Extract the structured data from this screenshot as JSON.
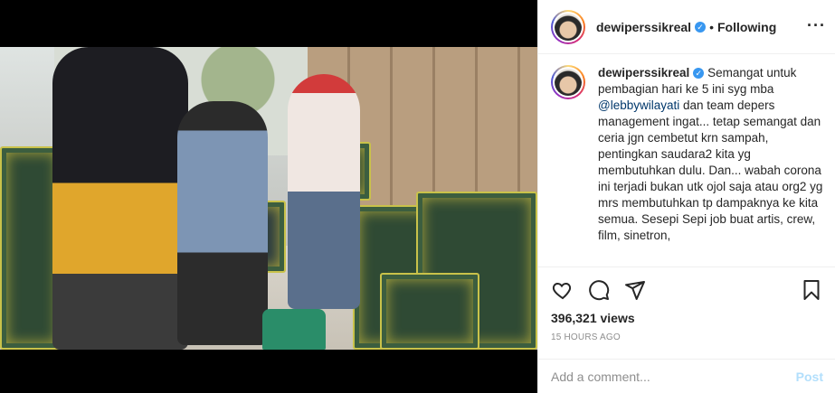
{
  "post": {
    "username": "dewiperssikreal",
    "follow_status": "Following",
    "separator": "•",
    "more_icon": "more-horizontal-icon"
  },
  "caption": {
    "username": "dewiperssikreal",
    "text_before": "Semangat untuk pembagian hari ke 5 ini syg mba ",
    "mention": "@lebbywilayati",
    "text_after": " dan team depers management ingat... tetap semangat dan ceria jgn cembetut krn sampah, pentingkan saudara2 kita yg membutuhkan dulu. Dan... wabah corona ini terjadi bukan utk ojol saja atau org2 yg mrs membutuhkan tp dampaknya ke kita semua. Sesepi Sepi job buat artis, crew, film, sinetron,"
  },
  "actions": {
    "icons": [
      "heart-icon",
      "comment-icon",
      "share-icon",
      "bookmark-icon"
    ],
    "views": "396,321 views",
    "time_ago": "15 HOURS AGO"
  },
  "comment": {
    "placeholder": "Add a comment...",
    "post_label": "Post"
  },
  "colors": {
    "verified": "#3897f0",
    "mention": "#00376b",
    "post_disabled": "#b2dffc",
    "muted": "#8e8e8e"
  }
}
